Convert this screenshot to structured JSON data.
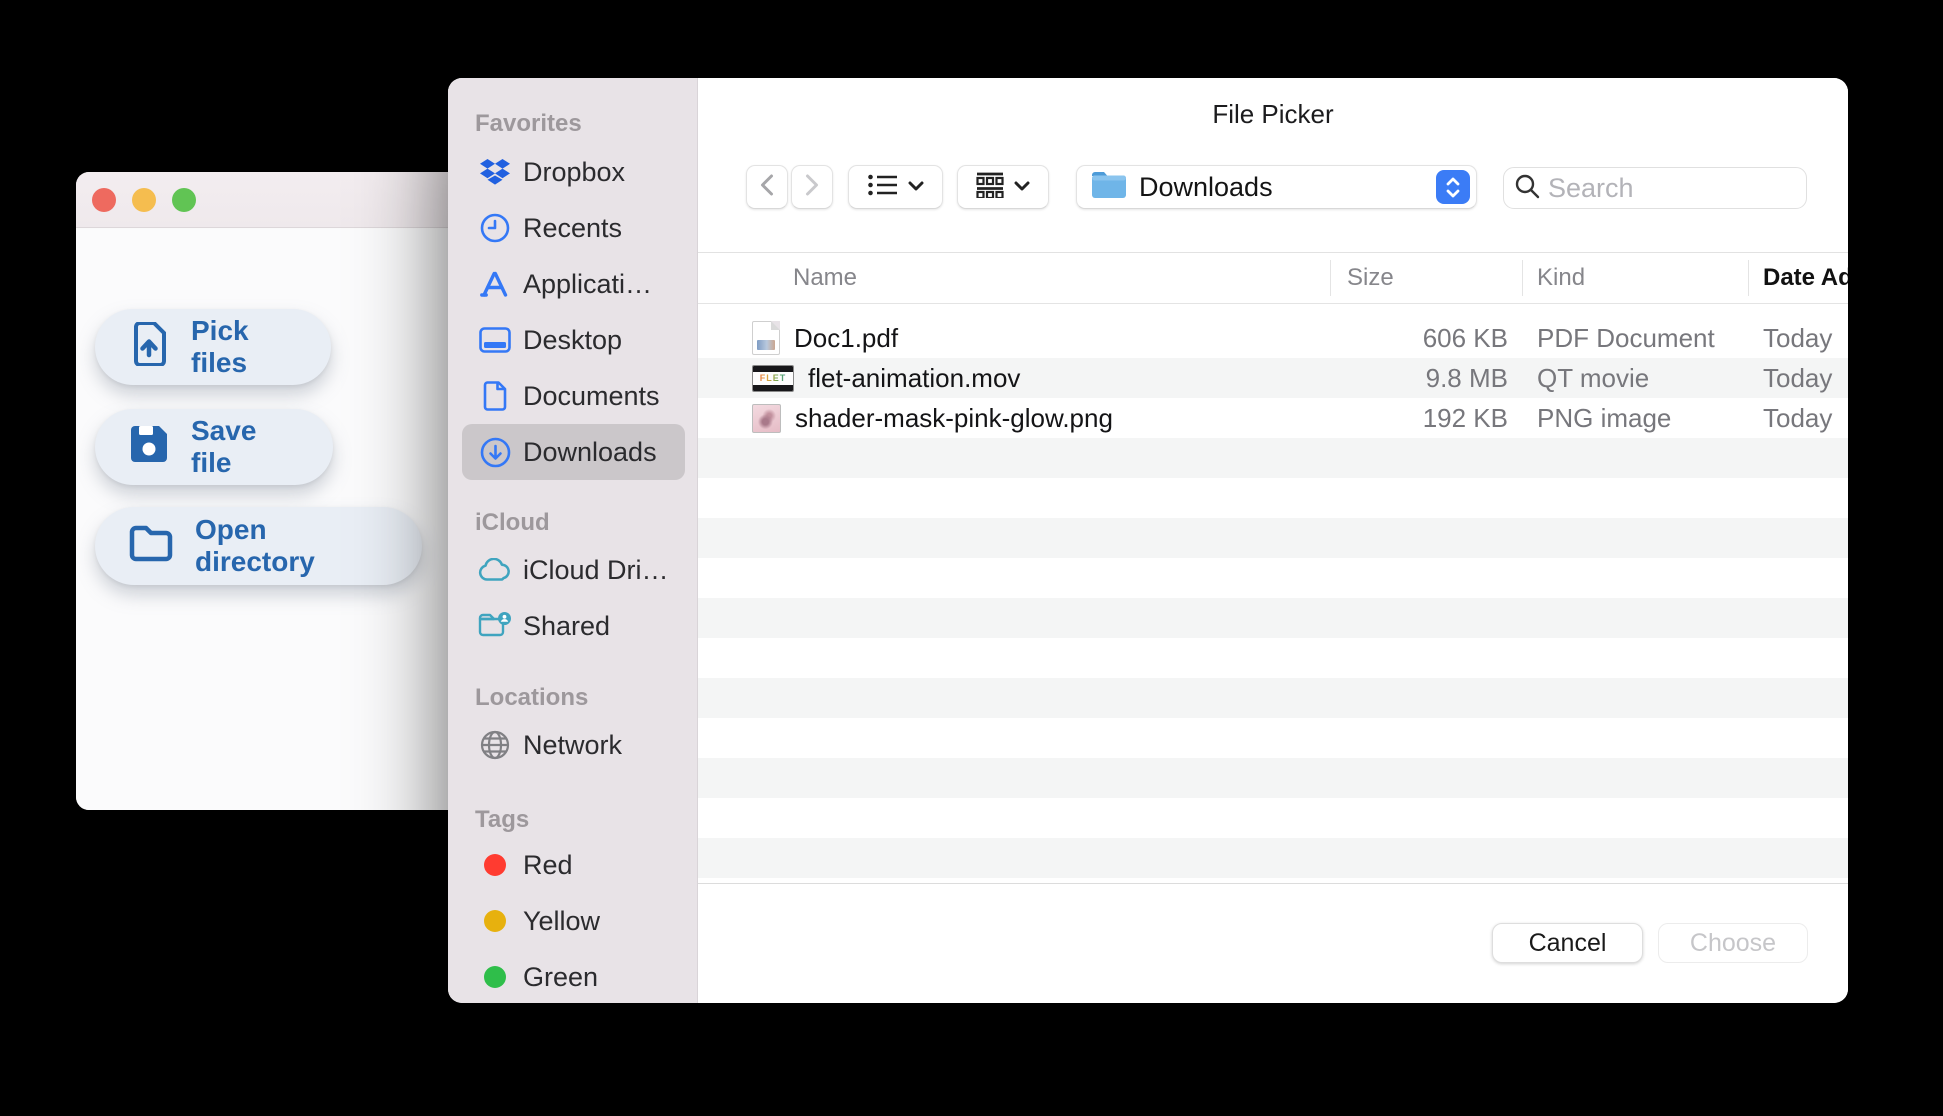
{
  "colors": {
    "accent_blue": "#3478f6",
    "button_text_blue": "#2766ad",
    "sidebar_bg": "#e8e3e7",
    "sidebar_selected_bg": "#cbc7ca",
    "row_stripe": "#f4f5f5",
    "traffic_red": "#ee6a5f",
    "traffic_yellow": "#f5bd4f",
    "traffic_green": "#61c454",
    "tag_red": "#ff3b30",
    "tag_yellow": "#e7b10e",
    "tag_green": "#2fbe4a",
    "icloud_teal": "#3fa4bf"
  },
  "icons": [
    "traffic-close",
    "traffic-minimize",
    "traffic-zoom",
    "file-upload",
    "floppy-save",
    "folder-open",
    "dropbox",
    "clock-recents",
    "appstore-a",
    "desktop-card",
    "document-page",
    "download-circle",
    "cloud",
    "shared-folder",
    "globe-network",
    "tag-dot",
    "chevron-left",
    "chevron-right",
    "list-view",
    "group-view",
    "chevron-down",
    "blue-folder",
    "stepper-updown",
    "magnifier",
    "pdf-thumb",
    "mov-thumb",
    "png-thumb"
  ],
  "back_window": {
    "buttons": [
      {
        "label": "Pick files"
      },
      {
        "label": "Save file"
      },
      {
        "label": "Open directory"
      }
    ]
  },
  "dialog": {
    "title": "File Picker",
    "toolbar": {
      "path_label": "Downloads",
      "search_placeholder": "Search"
    },
    "sidebar": {
      "sections": [
        {
          "title": "Favorites",
          "items": [
            {
              "label": "Dropbox"
            },
            {
              "label": "Recents"
            },
            {
              "label": "Applicati…"
            },
            {
              "label": "Desktop"
            },
            {
              "label": "Documents"
            },
            {
              "label": "Downloads",
              "selected": true
            }
          ]
        },
        {
          "title": "iCloud",
          "items": [
            {
              "label": "iCloud Dri…"
            },
            {
              "label": "Shared"
            }
          ]
        },
        {
          "title": "Locations",
          "items": [
            {
              "label": "Network"
            }
          ]
        },
        {
          "title": "Tags",
          "items": [
            {
              "label": "Red",
              "style": "background:#ff3b30"
            },
            {
              "label": "Yellow",
              "style": "background:#e7b10e"
            },
            {
              "label": "Green",
              "style": "background:#2fbe4a"
            }
          ]
        }
      ]
    },
    "table": {
      "columns": [
        "Name",
        "Size",
        "Kind",
        "Date Added"
      ],
      "rows": [
        {
          "name": "Doc1.pdf",
          "size": "606 KB",
          "kind": "PDF Document",
          "date": "Today",
          "thumb": "pdf"
        },
        {
          "name": "flet-animation.mov",
          "size": "9.8 MB",
          "kind": "QT movie",
          "date": "Today",
          "thumb": "mov",
          "thumb_text": "FLET"
        },
        {
          "name": "shader-mask-pink-glow.png",
          "size": "192 KB",
          "kind": "PNG image",
          "date": "Today",
          "thumb": "png"
        }
      ]
    },
    "footer": {
      "cancel_label": "Cancel",
      "choose_label": "Choose"
    }
  }
}
